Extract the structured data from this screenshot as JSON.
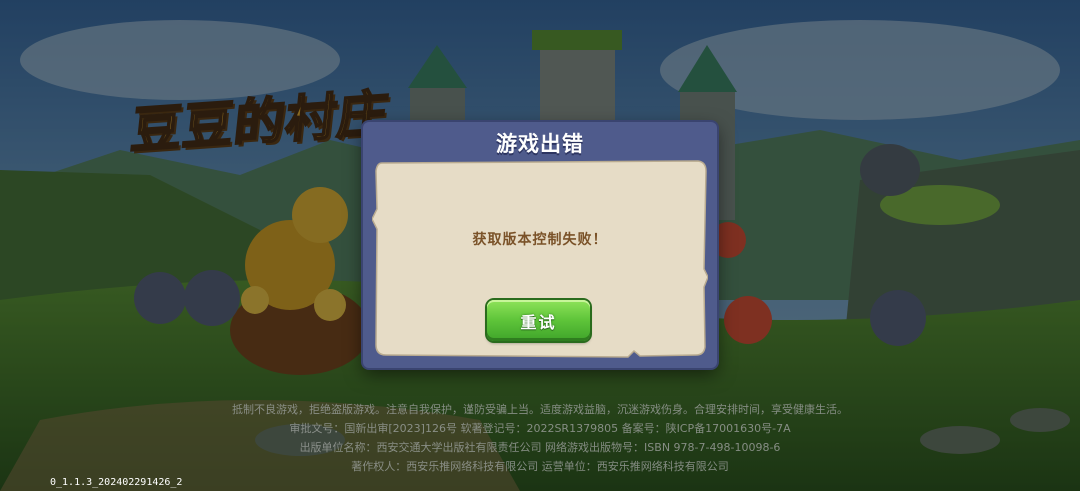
{
  "game": {
    "logo_text": "豆豆的村庄"
  },
  "dialog": {
    "title": "游戏出错",
    "message": "获取版本控制失败！",
    "retry_label": "重试"
  },
  "notice": {
    "line1": "抵制不良游戏，拒绝盗版游戏。注意自我保护，谨防受骗上当。适度游戏益脑，沉迷游戏伤身。合理安排时间，享受健康生活。",
    "line2": "审批文号：国新出审[2023]126号 软著登记号：2022SR1379805 备案号：陕ICP备17001630号-7A",
    "line3": "出版单位名称：西安交通大学出版社有限责任公司 网络游戏出版物号：ISBN 978-7-498-10098-6",
    "line4": "著作权人：西安乐推网络科技有限公司 运营单位：西安乐推网络科技有限公司"
  },
  "version": "0_1.1.3_202402291426_2",
  "colors": {
    "dialog_frame": "#4f5b8c",
    "dialog_panel": "#e6dcc6",
    "message_text": "#7a5228",
    "retry_button": "#5fc53a"
  }
}
